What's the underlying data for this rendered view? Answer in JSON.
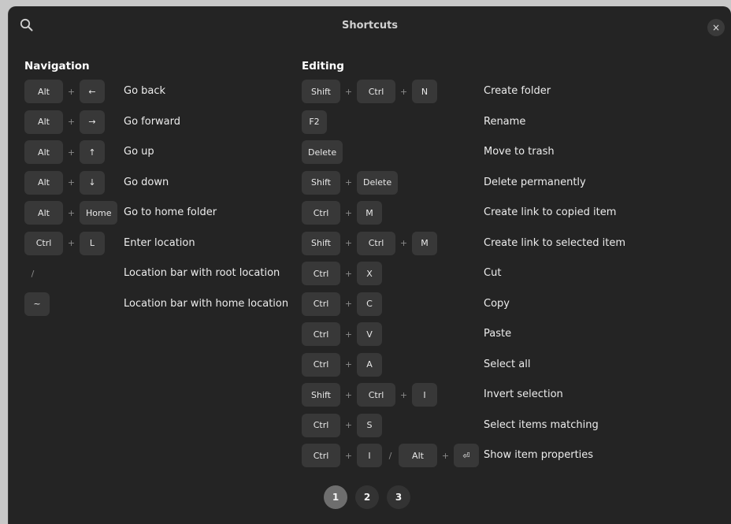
{
  "window": {
    "title": "Shortcuts",
    "close_glyph": "×"
  },
  "sections": {
    "navigation": {
      "title": "Navigation",
      "rows": [
        {
          "keys": [
            "Alt",
            "+",
            "←"
          ],
          "desc": "Go back"
        },
        {
          "keys": [
            "Alt",
            "+",
            "→"
          ],
          "desc": "Go forward"
        },
        {
          "keys": [
            "Alt",
            "+",
            "↑"
          ],
          "desc": "Go up"
        },
        {
          "keys": [
            "Alt",
            "+",
            "↓"
          ],
          "desc": "Go down"
        },
        {
          "keys": [
            "Alt",
            "+",
            "Home"
          ],
          "desc": "Go to home folder"
        },
        {
          "keys": [
            "Ctrl",
            "+",
            "L"
          ],
          "desc": "Enter location"
        },
        {
          "keys": [
            "/"
          ],
          "desc": "Location bar with root location"
        },
        {
          "keys": [
            "~"
          ],
          "desc": "Location bar with home location"
        }
      ]
    },
    "editing": {
      "title": "Editing",
      "rows": [
        {
          "keys": [
            "Shift",
            "+",
            "Ctrl",
            "+",
            "N"
          ],
          "desc": "Create folder"
        },
        {
          "keys": [
            "F2"
          ],
          "desc": "Rename"
        },
        {
          "keys": [
            "Delete"
          ],
          "desc": "Move to trash"
        },
        {
          "keys": [
            "Shift",
            "+",
            "Delete"
          ],
          "desc": "Delete permanently"
        },
        {
          "keys": [
            "Ctrl",
            "+",
            "M"
          ],
          "desc": "Create link to copied item"
        },
        {
          "keys": [
            "Shift",
            "+",
            "Ctrl",
            "+",
            "M"
          ],
          "desc": "Create link to selected item"
        },
        {
          "keys": [
            "Ctrl",
            "+",
            "X"
          ],
          "desc": "Cut"
        },
        {
          "keys": [
            "Ctrl",
            "+",
            "C"
          ],
          "desc": "Copy"
        },
        {
          "keys": [
            "Ctrl",
            "+",
            "V"
          ],
          "desc": "Paste"
        },
        {
          "keys": [
            "Ctrl",
            "+",
            "A"
          ],
          "desc": "Select all"
        },
        {
          "keys": [
            "Shift",
            "+",
            "Ctrl",
            "+",
            "I"
          ],
          "desc": "Invert selection"
        },
        {
          "keys": [
            "Ctrl",
            "+",
            "S"
          ],
          "desc": "Select items matching"
        },
        {
          "keys": [
            "Ctrl",
            "+",
            "I",
            "/",
            "Alt",
            "+",
            "⏎"
          ],
          "desc": "Show item properties"
        }
      ]
    }
  },
  "pagination": {
    "pages": [
      "1",
      "2",
      "3"
    ],
    "active_page": "1"
  },
  "icons": {
    "search": "search-icon",
    "close": "close-icon"
  },
  "colors": {
    "background": "#242424",
    "key": "#383838",
    "active_page": "#6e6e6e"
  }
}
